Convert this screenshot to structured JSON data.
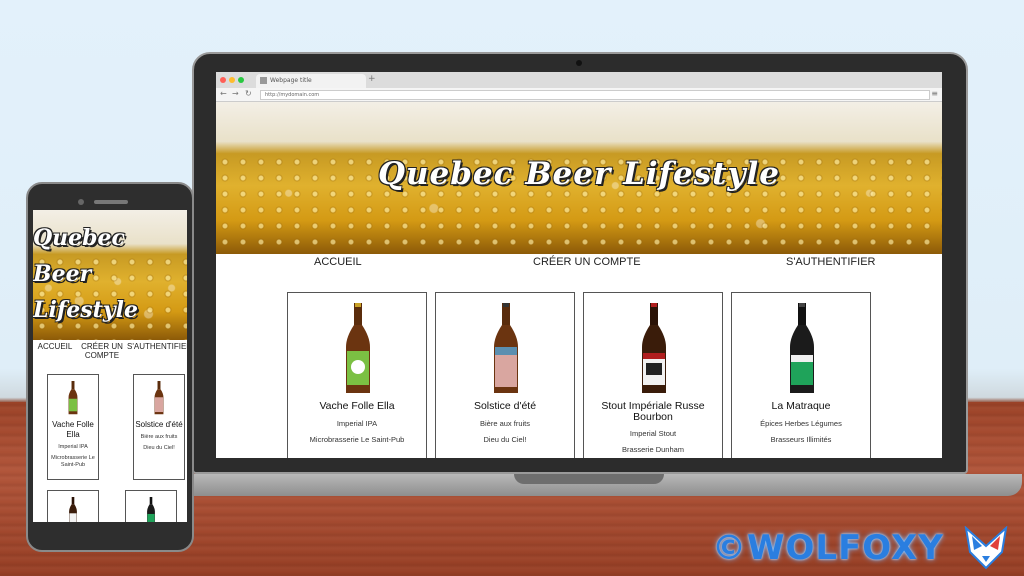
{
  "site": {
    "title": "Quebec Beer Lifestyle",
    "nav": [
      "ACCUEIL",
      "CRÉER UN COMPTE",
      "S'AUTHENTIFIER"
    ]
  },
  "browser": {
    "tab_label": "Webpage title",
    "url": "http://mydomain.com"
  },
  "beers": [
    {
      "name": "Vache Folle Ella",
      "style": "Imperial IPA",
      "brewery": "Microbrasserie Le Saint-Pub",
      "bottle_color": "#6b3410",
      "label_color": "#7bc043"
    },
    {
      "name": "Solstice d'été",
      "style": "Bière aux fruits",
      "brewery": "Dieu du Ciel!",
      "bottle_color": "#6b3410",
      "label_color": "#d9a6a0"
    },
    {
      "name": "Stout Impériale Russe Bourbon",
      "style": "Imperial Stout",
      "brewery": "Brasserie Dunham",
      "bottle_color": "#3a1c0a",
      "label_color": "#ffffff"
    },
    {
      "name": "La Matraque",
      "style": "Épices Herbes Légumes",
      "brewery": "Brasseurs Illimités",
      "bottle_color": "#1b1b1b",
      "label_color": "#1fa35a"
    }
  ],
  "phone": {
    "nav": [
      "ACCUEIL",
      "CRÉER UN COMPTE",
      "S'AUTHENTIFIER"
    ]
  },
  "watermark": "©WOLFOXY",
  "colors": {
    "accent": "#2a7ee0"
  }
}
